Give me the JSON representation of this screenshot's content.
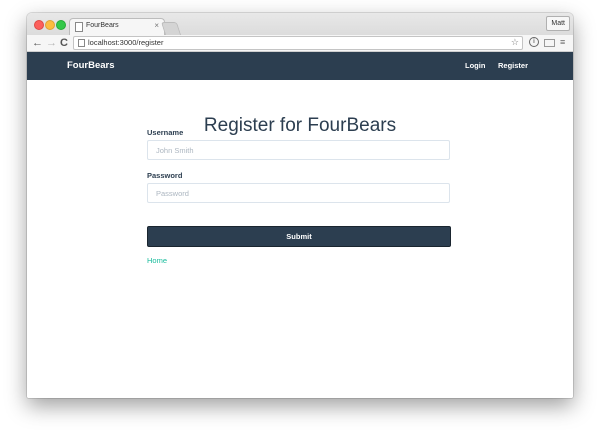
{
  "browser": {
    "tab_title": "FourBears",
    "tab_close": "×",
    "profile_name": "Matt",
    "url": "localhost:3000/register",
    "back": "←",
    "forward": "→",
    "reload": "C",
    "info": "i",
    "menu": "≡",
    "star": "☆"
  },
  "navbar": {
    "brand": "FourBears",
    "links": [
      "Login",
      "Register"
    ]
  },
  "form": {
    "heading": "Register for FourBears",
    "username_label": "Username",
    "username_placeholder": "John Smith",
    "username_value": "",
    "password_label": "Password",
    "password_placeholder": "Password",
    "password_value": "",
    "submit_label": "Submit"
  },
  "footer_link": "Home",
  "colors": {
    "navbar_bg": "#2c3e50",
    "link": "#18bc9c",
    "heading": "#2c3e50"
  },
  "icons": [
    "close-icon",
    "document-icon",
    "back-arrow-icon",
    "forward-arrow-icon",
    "reload-icon",
    "star-icon",
    "info-icon",
    "cast-icon",
    "menu-icon"
  ]
}
